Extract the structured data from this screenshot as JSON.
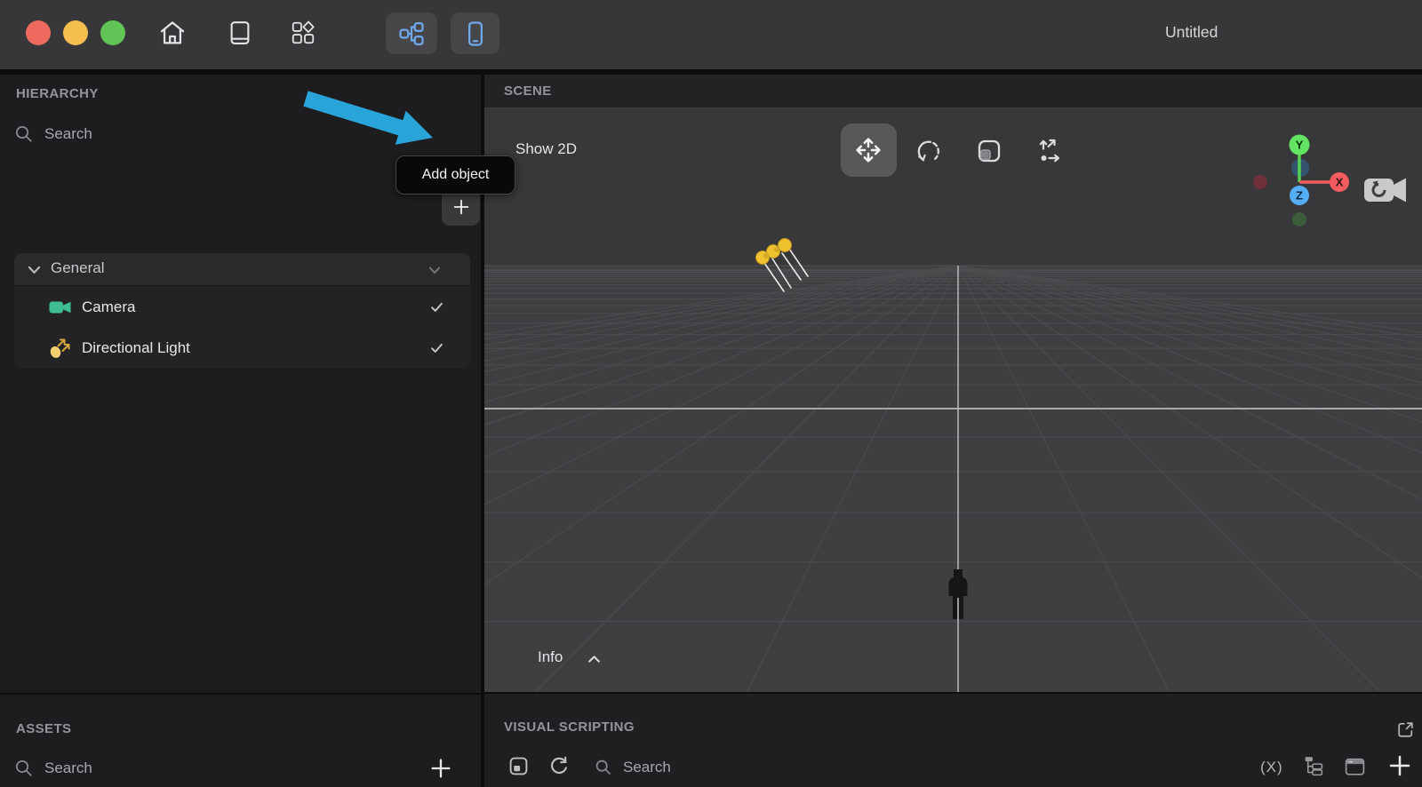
{
  "window": {
    "title": "Untitled"
  },
  "topbar": {
    "traffic_lights": [
      "close",
      "minimize",
      "zoom"
    ],
    "nav_icons": [
      "home-icon",
      "book-icon",
      "shapes-icon"
    ],
    "mode_buttons": [
      "node-graph",
      "device-preview"
    ]
  },
  "hierarchy": {
    "title": "HIERARCHY",
    "search_placeholder": "Search",
    "add_tooltip": "Add object",
    "groups": [
      {
        "label": "General",
        "items": [
          {
            "label": "Camera",
            "icon": "camera-icon",
            "enabled": true
          },
          {
            "label": "Directional Light",
            "icon": "directional-light-icon",
            "enabled": true
          }
        ]
      }
    ]
  },
  "assets": {
    "title": "ASSETS",
    "search_placeholder": "Search"
  },
  "scene": {
    "title": "SCENE",
    "show_2d_label": "Show 2D",
    "info_label": "Info",
    "active_tool": "move",
    "tools": [
      "move",
      "rotate",
      "scale",
      "transform"
    ],
    "axis_gizmo": {
      "x": "X",
      "y": "Y",
      "z": "Z"
    }
  },
  "visual_scripting": {
    "title": "VISUAL SCRIPTING",
    "search_placeholder": "Search",
    "fx_label": "(X)"
  },
  "colors": {
    "annotation_arrow": "#29A4D9",
    "axis_x": "#F25C5E",
    "axis_y": "#63E463",
    "axis_z": "#55AEF5",
    "camera_icon": "#3EBD92",
    "light_icon": "#F4CF70",
    "traffic_red": "#EE6A5F",
    "traffic_yellow": "#F5BE4F",
    "traffic_green": "#61C555",
    "mode_icon_blue": "#6FA8EC"
  }
}
